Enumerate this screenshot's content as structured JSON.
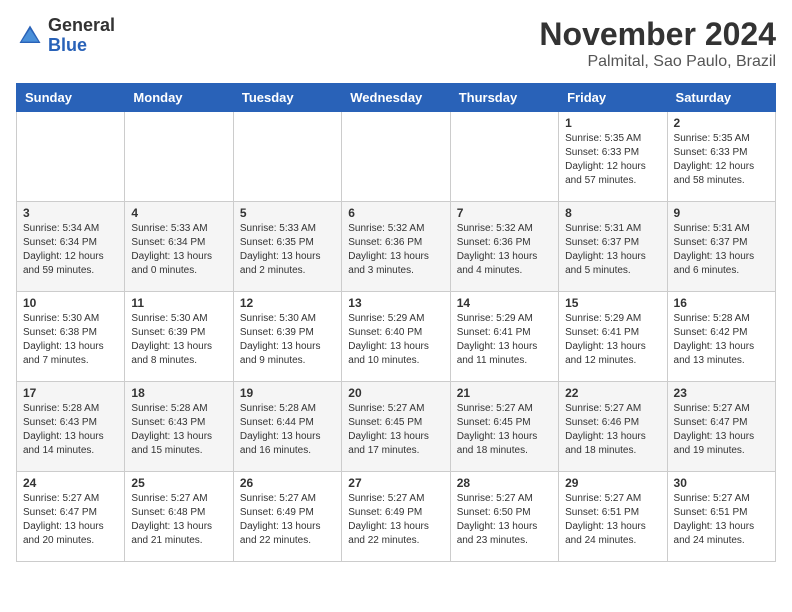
{
  "logo": {
    "general": "General",
    "blue": "Blue"
  },
  "header": {
    "month": "November 2024",
    "location": "Palmital, Sao Paulo, Brazil"
  },
  "days_of_week": [
    "Sunday",
    "Monday",
    "Tuesday",
    "Wednesday",
    "Thursday",
    "Friday",
    "Saturday"
  ],
  "weeks": [
    [
      {
        "day": "",
        "info": ""
      },
      {
        "day": "",
        "info": ""
      },
      {
        "day": "",
        "info": ""
      },
      {
        "day": "",
        "info": ""
      },
      {
        "day": "",
        "info": ""
      },
      {
        "day": "1",
        "info": "Sunrise: 5:35 AM\nSunset: 6:33 PM\nDaylight: 12 hours and 57 minutes."
      },
      {
        "day": "2",
        "info": "Sunrise: 5:35 AM\nSunset: 6:33 PM\nDaylight: 12 hours and 58 minutes."
      }
    ],
    [
      {
        "day": "3",
        "info": "Sunrise: 5:34 AM\nSunset: 6:34 PM\nDaylight: 12 hours and 59 minutes."
      },
      {
        "day": "4",
        "info": "Sunrise: 5:33 AM\nSunset: 6:34 PM\nDaylight: 13 hours and 0 minutes."
      },
      {
        "day": "5",
        "info": "Sunrise: 5:33 AM\nSunset: 6:35 PM\nDaylight: 13 hours and 2 minutes."
      },
      {
        "day": "6",
        "info": "Sunrise: 5:32 AM\nSunset: 6:36 PM\nDaylight: 13 hours and 3 minutes."
      },
      {
        "day": "7",
        "info": "Sunrise: 5:32 AM\nSunset: 6:36 PM\nDaylight: 13 hours and 4 minutes."
      },
      {
        "day": "8",
        "info": "Sunrise: 5:31 AM\nSunset: 6:37 PM\nDaylight: 13 hours and 5 minutes."
      },
      {
        "day": "9",
        "info": "Sunrise: 5:31 AM\nSunset: 6:37 PM\nDaylight: 13 hours and 6 minutes."
      }
    ],
    [
      {
        "day": "10",
        "info": "Sunrise: 5:30 AM\nSunset: 6:38 PM\nDaylight: 13 hours and 7 minutes."
      },
      {
        "day": "11",
        "info": "Sunrise: 5:30 AM\nSunset: 6:39 PM\nDaylight: 13 hours and 8 minutes."
      },
      {
        "day": "12",
        "info": "Sunrise: 5:30 AM\nSunset: 6:39 PM\nDaylight: 13 hours and 9 minutes."
      },
      {
        "day": "13",
        "info": "Sunrise: 5:29 AM\nSunset: 6:40 PM\nDaylight: 13 hours and 10 minutes."
      },
      {
        "day": "14",
        "info": "Sunrise: 5:29 AM\nSunset: 6:41 PM\nDaylight: 13 hours and 11 minutes."
      },
      {
        "day": "15",
        "info": "Sunrise: 5:29 AM\nSunset: 6:41 PM\nDaylight: 13 hours and 12 minutes."
      },
      {
        "day": "16",
        "info": "Sunrise: 5:28 AM\nSunset: 6:42 PM\nDaylight: 13 hours and 13 minutes."
      }
    ],
    [
      {
        "day": "17",
        "info": "Sunrise: 5:28 AM\nSunset: 6:43 PM\nDaylight: 13 hours and 14 minutes."
      },
      {
        "day": "18",
        "info": "Sunrise: 5:28 AM\nSunset: 6:43 PM\nDaylight: 13 hours and 15 minutes."
      },
      {
        "day": "19",
        "info": "Sunrise: 5:28 AM\nSunset: 6:44 PM\nDaylight: 13 hours and 16 minutes."
      },
      {
        "day": "20",
        "info": "Sunrise: 5:27 AM\nSunset: 6:45 PM\nDaylight: 13 hours and 17 minutes."
      },
      {
        "day": "21",
        "info": "Sunrise: 5:27 AM\nSunset: 6:45 PM\nDaylight: 13 hours and 18 minutes."
      },
      {
        "day": "22",
        "info": "Sunrise: 5:27 AM\nSunset: 6:46 PM\nDaylight: 13 hours and 18 minutes."
      },
      {
        "day": "23",
        "info": "Sunrise: 5:27 AM\nSunset: 6:47 PM\nDaylight: 13 hours and 19 minutes."
      }
    ],
    [
      {
        "day": "24",
        "info": "Sunrise: 5:27 AM\nSunset: 6:47 PM\nDaylight: 13 hours and 20 minutes."
      },
      {
        "day": "25",
        "info": "Sunrise: 5:27 AM\nSunset: 6:48 PM\nDaylight: 13 hours and 21 minutes."
      },
      {
        "day": "26",
        "info": "Sunrise: 5:27 AM\nSunset: 6:49 PM\nDaylight: 13 hours and 22 minutes."
      },
      {
        "day": "27",
        "info": "Sunrise: 5:27 AM\nSunset: 6:49 PM\nDaylight: 13 hours and 22 minutes."
      },
      {
        "day": "28",
        "info": "Sunrise: 5:27 AM\nSunset: 6:50 PM\nDaylight: 13 hours and 23 minutes."
      },
      {
        "day": "29",
        "info": "Sunrise: 5:27 AM\nSunset: 6:51 PM\nDaylight: 13 hours and 24 minutes."
      },
      {
        "day": "30",
        "info": "Sunrise: 5:27 AM\nSunset: 6:51 PM\nDaylight: 13 hours and 24 minutes."
      }
    ]
  ]
}
